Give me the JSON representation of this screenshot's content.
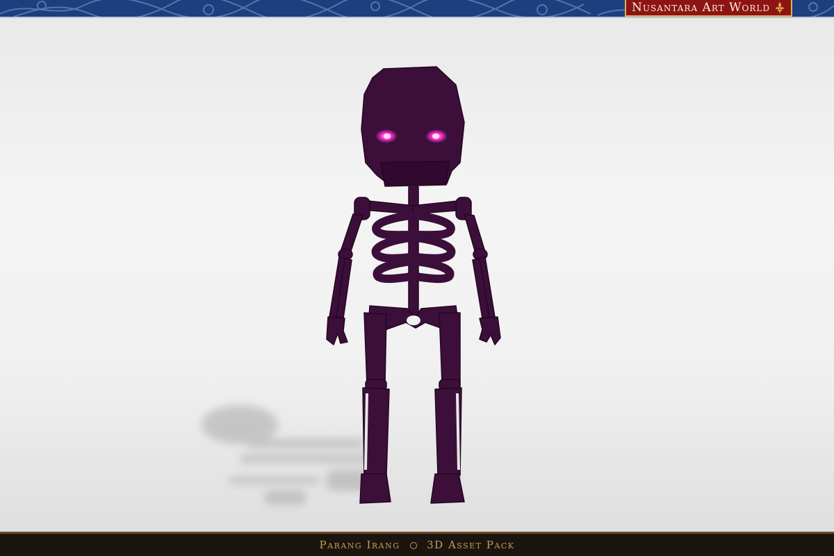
{
  "header": {
    "brand_label": "Nusantara Art World",
    "brand_emblem": "fleur-de-lis-icon",
    "banner_color": "#1d3f7d",
    "brand_color": "#8e1414"
  },
  "scene": {
    "subject": "skeleton-model",
    "body_color": "#3c0f3a",
    "eye_color": "#ff2fd2"
  },
  "footer": {
    "title_left": "Parang Irang",
    "title_right": "3D Asset Pack",
    "separator_icon": "circle-separator-icon",
    "text_color": "#c79e58"
  }
}
